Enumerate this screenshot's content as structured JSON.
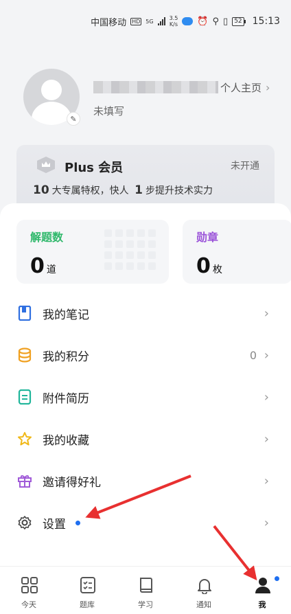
{
  "status_bar": {
    "carrier": "中国移动",
    "hd": "HD",
    "net": "5G",
    "speed_top": "3.5",
    "speed_bottom": "K/s",
    "battery": "52",
    "time": "15:13"
  },
  "profile": {
    "home_link": "个人主页",
    "bio": "未填写"
  },
  "plus": {
    "title": "Plus 会员",
    "status": "未开通",
    "desc_num1": "10",
    "desc_text1": "大专属特权，快人",
    "desc_num2": "1",
    "desc_text2": "步提升技术实力"
  },
  "stats": {
    "solved": {
      "title": "解题数",
      "value": "0",
      "unit": "道",
      "color": "#2fb86b"
    },
    "badges": {
      "title": "勋章",
      "value": "0",
      "unit": "枚",
      "color": "#9b54d9"
    }
  },
  "menu": [
    {
      "label": "我的笔记",
      "value": "",
      "icon": "notebook-icon",
      "color": "#2f6fe0"
    },
    {
      "label": "我的积分",
      "value": "0",
      "icon": "coins-icon",
      "color": "#f0a020"
    },
    {
      "label": "附件简历",
      "value": "",
      "icon": "resume-icon",
      "color": "#1fb59a"
    },
    {
      "label": "我的收藏",
      "value": "",
      "icon": "star-icon",
      "color": "#f0b818"
    },
    {
      "label": "邀请得好礼",
      "value": "",
      "icon": "gift-icon",
      "color": "#a05ad8"
    },
    {
      "label": "设置",
      "value": "",
      "icon": "gear-icon",
      "color": "#444444"
    }
  ],
  "nav": [
    {
      "label": "今天",
      "icon": "grid-icon"
    },
    {
      "label": "题库",
      "icon": "checklist-icon"
    },
    {
      "label": "学习",
      "icon": "book-icon"
    },
    {
      "label": "通知",
      "icon": "bell-icon"
    },
    {
      "label": "我",
      "icon": "profile-icon"
    }
  ],
  "colors": {
    "annotation_arrow": "#e83030",
    "accent_dot": "#1f6ff0"
  }
}
